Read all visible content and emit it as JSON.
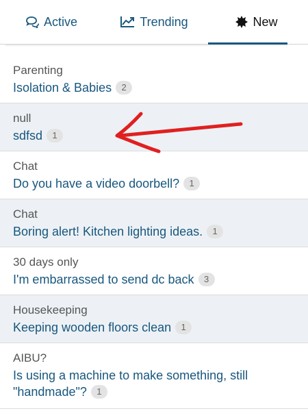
{
  "tabs": [
    {
      "label": "Active",
      "icon": "chat-bubbles-icon"
    },
    {
      "label": "Trending",
      "icon": "trending-chart-icon"
    },
    {
      "label": "New",
      "icon": "starburst-icon",
      "active": true
    }
  ],
  "threads": [
    {
      "topic": "Parenting",
      "title": "Isolation & Babies",
      "count": "2"
    },
    {
      "topic": "null",
      "title": "sdfsd",
      "count": "1"
    },
    {
      "topic": "Chat",
      "title": "Do you have a video doorbell?",
      "count": "1"
    },
    {
      "topic": "Chat",
      "title": "Boring alert! Kitchen lighting ideas.",
      "count": "1"
    },
    {
      "topic": "30 days only",
      "title": "I'm embarrassed to send dc back",
      "count": "3"
    },
    {
      "topic": "Housekeeping",
      "title": "Keeping wooden floors clean",
      "count": "1"
    },
    {
      "topic": "AIBU?",
      "title": "Is using a machine to make something, still \"handmade\"?",
      "count": "1"
    }
  ],
  "colors": {
    "link": "#17577e",
    "shaded_row": "#edf1f5",
    "annotation_arrow": "#e02020"
  }
}
